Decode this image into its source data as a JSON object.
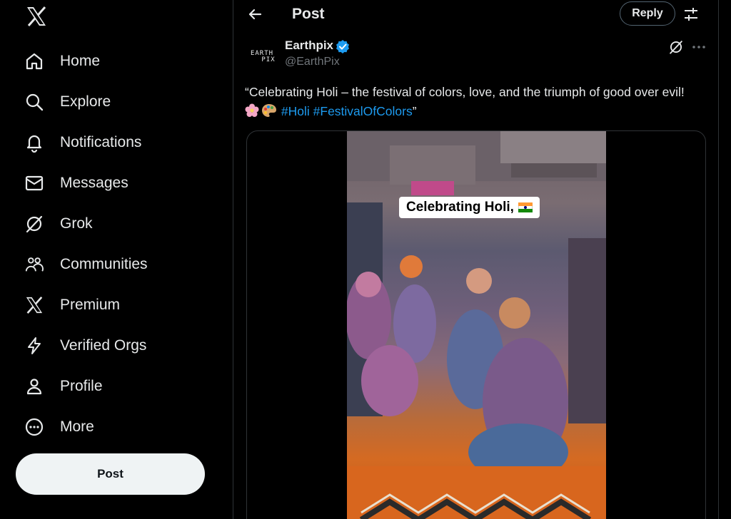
{
  "colors": {
    "background": "#000000",
    "text_primary": "#e7e9ea",
    "text_secondary": "#71767b",
    "accent_blue": "#1d9bf0",
    "post_button_bg": "#eff3f4",
    "divider": "#2f3336"
  },
  "logo": {
    "icon": "x-logo-icon"
  },
  "nav": {
    "items": [
      {
        "label": "Home",
        "icon": "home-icon"
      },
      {
        "label": "Explore",
        "icon": "search-icon"
      },
      {
        "label": "Notifications",
        "icon": "bell-icon"
      },
      {
        "label": "Messages",
        "icon": "envelope-icon"
      },
      {
        "label": "Grok",
        "icon": "grok-icon"
      },
      {
        "label": "Communities",
        "icon": "people-icon"
      },
      {
        "label": "Premium",
        "icon": "x-logo-icon"
      },
      {
        "label": "Verified Orgs",
        "icon": "lightning-icon"
      },
      {
        "label": "Profile",
        "icon": "person-icon"
      },
      {
        "label": "More",
        "icon": "more-circle-icon"
      }
    ],
    "post_label": "Post"
  },
  "header": {
    "title": "Post",
    "reply_label": "Reply"
  },
  "tweet": {
    "author_name": "Earthpix",
    "author_handle": "@EarthPix",
    "avatar_text_line1": "EARTH",
    "avatar_text_line2": "PIX",
    "verified": true,
    "text_before": "“Celebrating Holi – the festival of colors, love, and the triumph of good over evil! ",
    "hashtag1": "#Holi",
    "hashtag2": "#FestivalOfColors",
    "text_after": "”",
    "emojis": [
      "blossom-emoji",
      "palette-emoji"
    ]
  },
  "media": {
    "caption": "Celebrating Holi,"
  }
}
